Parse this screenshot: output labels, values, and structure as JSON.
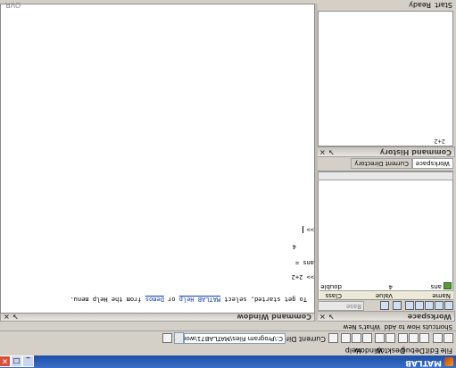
{
  "window": {
    "title": "MATLAB"
  },
  "menu": [
    "File",
    "Edit",
    "Debug",
    "Desktop",
    "Window",
    "Help"
  ],
  "toolbar": {
    "current_dir_label": "Current Directory:",
    "current_dir_value": "C:\\Program Files\\MATLAB71\\work"
  },
  "shortcuts": [
    "Shortcuts",
    "How to Add",
    "What's New"
  ],
  "tabs": [
    "Workspace",
    "Current Directory"
  ],
  "panels": {
    "workspace": {
      "title": "Workspace",
      "stack_label": "Base",
      "columns": [
        "Name",
        "Value",
        "Class"
      ],
      "rows": [
        {
          "name": "ans",
          "value": "4",
          "class": "double"
        }
      ]
    },
    "history": {
      "title": "Command History",
      "entries": [
        "2+2"
      ]
    },
    "command": {
      "title": "Command Window",
      "intro_prefix": "To get started, select ",
      "help_link": "MATLAB Help",
      "intro_mid": " or ",
      "demos_link": "Demos",
      "intro_suffix": " from the Help menu.",
      "lines": [
        ">> 2+2",
        "ans =",
        "4",
        ">> "
      ]
    }
  },
  "statusbar": {
    "start": "Start",
    "status": "Ready",
    "ovr": "OVR"
  }
}
